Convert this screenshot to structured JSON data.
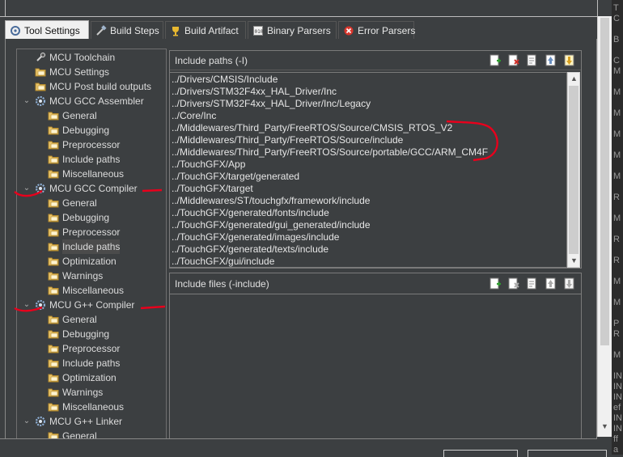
{
  "tabs": [
    {
      "label": "Tool Settings",
      "icon": "tool-settings-icon",
      "active": true
    },
    {
      "label": "Build Steps",
      "icon": "build-steps-icon"
    },
    {
      "label": "Build Artifact",
      "icon": "build-artifact-icon"
    },
    {
      "label": "Binary Parsers",
      "icon": "binary-parsers-icon"
    },
    {
      "label": "Error Parsers",
      "icon": "error-parsers-icon"
    }
  ],
  "tree": [
    {
      "label": "MCU Toolchain",
      "level": 0,
      "icon": "toolchain-icon"
    },
    {
      "label": "MCU Settings",
      "level": 0,
      "icon": "folder-icon"
    },
    {
      "label": "MCU Post build outputs",
      "level": 0,
      "icon": "folder-icon"
    },
    {
      "label": "MCU GCC Assembler",
      "level": 0,
      "icon": "gear-icon",
      "expanded": true
    },
    {
      "label": "General",
      "level": 1,
      "icon": "folder-icon"
    },
    {
      "label": "Debugging",
      "level": 1,
      "icon": "folder-icon"
    },
    {
      "label": "Preprocessor",
      "level": 1,
      "icon": "folder-icon"
    },
    {
      "label": "Include paths",
      "level": 1,
      "icon": "folder-icon"
    },
    {
      "label": "Miscellaneous",
      "level": 1,
      "icon": "folder-icon"
    },
    {
      "label": "MCU GCC Compiler",
      "level": 0,
      "icon": "gear-icon",
      "expanded": true
    },
    {
      "label": "General",
      "level": 1,
      "icon": "folder-icon"
    },
    {
      "label": "Debugging",
      "level": 1,
      "icon": "folder-icon"
    },
    {
      "label": "Preprocessor",
      "level": 1,
      "icon": "folder-icon"
    },
    {
      "label": "Include paths",
      "level": 1,
      "icon": "folder-icon",
      "selected": true
    },
    {
      "label": "Optimization",
      "level": 1,
      "icon": "folder-icon"
    },
    {
      "label": "Warnings",
      "level": 1,
      "icon": "folder-icon"
    },
    {
      "label": "Miscellaneous",
      "level": 1,
      "icon": "folder-icon"
    },
    {
      "label": "MCU G++ Compiler",
      "level": 0,
      "icon": "gear-icon",
      "expanded": true
    },
    {
      "label": "General",
      "level": 1,
      "icon": "folder-icon"
    },
    {
      "label": "Debugging",
      "level": 1,
      "icon": "folder-icon"
    },
    {
      "label": "Preprocessor",
      "level": 1,
      "icon": "folder-icon"
    },
    {
      "label": "Include paths",
      "level": 1,
      "icon": "folder-icon"
    },
    {
      "label": "Optimization",
      "level": 1,
      "icon": "folder-icon"
    },
    {
      "label": "Warnings",
      "level": 1,
      "icon": "folder-icon"
    },
    {
      "label": "Miscellaneous",
      "level": 1,
      "icon": "folder-icon"
    },
    {
      "label": "MCU G++ Linker",
      "level": 0,
      "icon": "gear-icon",
      "expanded": true
    },
    {
      "label": "General",
      "level": 1,
      "icon": "folder-icon"
    }
  ],
  "include_paths": {
    "title": "Include paths (-I)",
    "items": [
      "../Drivers/CMSIS/Include",
      "../Drivers/STM32F4xx_HAL_Driver/Inc",
      "../Drivers/STM32F4xx_HAL_Driver/Inc/Legacy",
      "../Core/Inc",
      "../Middlewares/Third_Party/FreeRTOS/Source/CMSIS_RTOS_V2",
      "../Middlewares/Third_Party/FreeRTOS/Source/include",
      "../Middlewares/Third_Party/FreeRTOS/Source/portable/GCC/ARM_CM4F",
      "../TouchGFX/App",
      "../TouchGFX/target/generated",
      "../TouchGFX/target",
      "../Middlewares/ST/touchgfx/framework/include",
      "../TouchGFX/generated/fonts/include",
      "../TouchGFX/generated/gui_generated/include",
      "../TouchGFX/generated/images/include",
      "../TouchGFX/generated/texts/include",
      "../TouchGFX/gui/include"
    ]
  },
  "include_files": {
    "title": "Include files (-include)",
    "items": []
  },
  "toolbar_icons": [
    "add-icon",
    "delete-icon",
    "edit-icon",
    "move-up-icon",
    "move-down-icon"
  ],
  "right_strip_chars": [
    "T",
    "C",
    "",
    "B",
    "",
    "C",
    "M",
    "",
    "M",
    "",
    "M",
    "",
    "M",
    "",
    "M",
    "",
    "M",
    "",
    "R",
    "",
    "M",
    "",
    "R",
    "",
    "R",
    "",
    "M",
    "",
    "M",
    "",
    "P",
    "R",
    "",
    "M",
    "",
    "IN",
    "IN",
    "IN",
    "ef",
    "IN",
    "IN",
    "ff",
    "a"
  ],
  "colors": {
    "annotation": "#e8001c",
    "background": "#3c3f41"
  }
}
